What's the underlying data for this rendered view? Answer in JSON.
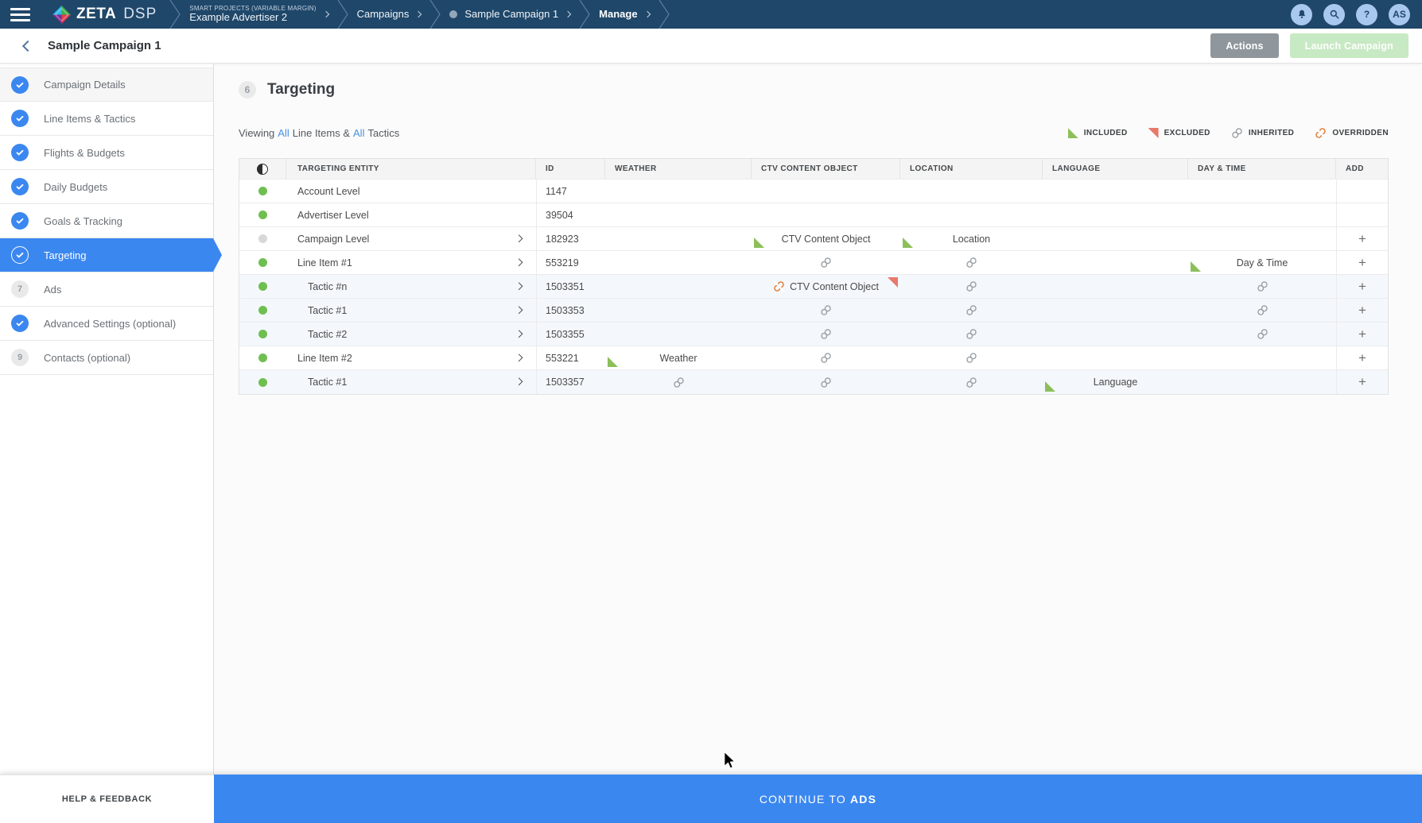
{
  "navbar": {
    "brand": "ZETA",
    "product": "DSP",
    "breadcrumbs": [
      {
        "top": "SMART PROJECTS (VARIABLE MARGIN)",
        "label": "Example Advertiser 2"
      },
      {
        "label": "Campaigns"
      },
      {
        "label": "Sample Campaign 1",
        "dot": true
      },
      {
        "label": "Manage",
        "bold": true
      }
    ],
    "avatar": "AS"
  },
  "header": {
    "title": "Sample Campaign 1",
    "actions": "Actions",
    "launch": "Launch Campaign"
  },
  "sidebar": {
    "items": [
      {
        "label": "Campaign Details",
        "state": "done",
        "shaded": true
      },
      {
        "label": "Line Items & Tactics",
        "state": "done"
      },
      {
        "label": "Flights & Budgets",
        "state": "done"
      },
      {
        "label": "Daily Budgets",
        "state": "done"
      },
      {
        "label": "Goals & Tracking",
        "state": "done"
      },
      {
        "label": "Targeting",
        "state": "active"
      },
      {
        "label": "Ads",
        "state": "pending",
        "number": "7"
      },
      {
        "label": "Advanced Settings (optional)",
        "state": "done"
      },
      {
        "label": "Contacts (optional)",
        "state": "pending",
        "number": "9"
      }
    ],
    "footer_label": "HELP & FEEDBACK"
  },
  "main": {
    "step_number": "6",
    "title": "Targeting",
    "viewing": {
      "prefix": "Viewing",
      "all1": "All",
      "middle": "Line Items &",
      "all2": "All",
      "suffix": "Tactics"
    },
    "legend": [
      {
        "type": "included",
        "label": "INCLUDED"
      },
      {
        "type": "excluded",
        "label": "EXCLUDED"
      },
      {
        "type": "inherited",
        "label": "INHERITED"
      },
      {
        "type": "overridden",
        "label": "OVERRIDDEN"
      }
    ],
    "table": {
      "columns": [
        "TARGETING ENTITY",
        "ID",
        "WEATHER",
        "CTV CONTENT OBJECT",
        "LOCATION",
        "LANGUAGE",
        "DAY & TIME",
        "ADD"
      ],
      "rows": [
        {
          "entity": "Account Level",
          "id": "1147",
          "dot": "green",
          "indent": 0,
          "expandable": false,
          "add": false,
          "tinted": false,
          "cells": {}
        },
        {
          "entity": "Advertiser Level",
          "id": "39504",
          "dot": "green",
          "indent": 0,
          "expandable": false,
          "add": false,
          "tinted": false,
          "cells": {}
        },
        {
          "entity": "Campaign Level",
          "id": "182923",
          "dot": "gray",
          "indent": 0,
          "expandable": true,
          "add": true,
          "tinted": false,
          "cells": {
            "ctv": {
              "label": "CTV Content Object",
              "marks": [
                "included"
              ]
            },
            "location": {
              "label": "Location",
              "marks": [
                "included"
              ]
            }
          }
        },
        {
          "entity": "Line Item #1",
          "id": "553219",
          "dot": "green",
          "indent": 0,
          "expandable": true,
          "add": true,
          "tinted": false,
          "cells": {
            "ctv": {
              "marks": [
                "inherited"
              ]
            },
            "location": {
              "marks": [
                "inherited"
              ]
            },
            "daytime": {
              "label": "Day & Time",
              "marks": [
                "included"
              ]
            }
          }
        },
        {
          "entity": "Tactic #n",
          "id": "1503351",
          "dot": "green",
          "indent": 1,
          "expandable": true,
          "add": true,
          "tinted": true,
          "cells": {
            "ctv": {
              "label": "CTV Content Object",
              "marks": [
                "overridden",
                "excluded"
              ]
            },
            "location": {
              "marks": [
                "inherited"
              ]
            },
            "daytime": {
              "marks": [
                "inherited"
              ]
            }
          }
        },
        {
          "entity": "Tactic #1",
          "id": "1503353",
          "dot": "green",
          "indent": 1,
          "expandable": true,
          "add": true,
          "tinted": true,
          "cells": {
            "ctv": {
              "marks": [
                "inherited"
              ]
            },
            "location": {
              "marks": [
                "inherited"
              ]
            },
            "daytime": {
              "marks": [
                "inherited"
              ]
            }
          }
        },
        {
          "entity": "Tactic #2",
          "id": "1503355",
          "dot": "green",
          "indent": 1,
          "expandable": true,
          "add": true,
          "tinted": true,
          "cells": {
            "ctv": {
              "marks": [
                "inherited"
              ]
            },
            "location": {
              "marks": [
                "inherited"
              ]
            },
            "daytime": {
              "marks": [
                "inherited"
              ]
            }
          }
        },
        {
          "entity": "Line Item #2",
          "id": "553221",
          "dot": "green",
          "indent": 0,
          "expandable": true,
          "add": true,
          "tinted": false,
          "cells": {
            "weather": {
              "label": "Weather",
              "marks": [
                "included"
              ]
            },
            "ctv": {
              "marks": [
                "inherited"
              ]
            },
            "location": {
              "marks": [
                "inherited"
              ]
            }
          }
        },
        {
          "entity": "Tactic #1",
          "id": "1503357",
          "dot": "green",
          "indent": 1,
          "expandable": true,
          "add": true,
          "tinted": true,
          "cells": {
            "weather": {
              "marks": [
                "inherited"
              ]
            },
            "ctv": {
              "marks": [
                "inherited"
              ]
            },
            "location": {
              "marks": [
                "inherited"
              ]
            },
            "language": {
              "label": "Language",
              "marks": [
                "included"
              ]
            }
          }
        }
      ]
    }
  },
  "footer": {
    "continue_prefix": "CONTINUE TO",
    "continue_emphasis": "ADS"
  },
  "colors": {
    "navbar": "#1f4769",
    "accent": "#3b87f0",
    "included": "#8cbf5a",
    "excluded": "#e8796c",
    "inherited": "#9aa0a6",
    "overridden": "#e2792f",
    "launch": "#c7e9c3",
    "actions": "#8f969c"
  }
}
